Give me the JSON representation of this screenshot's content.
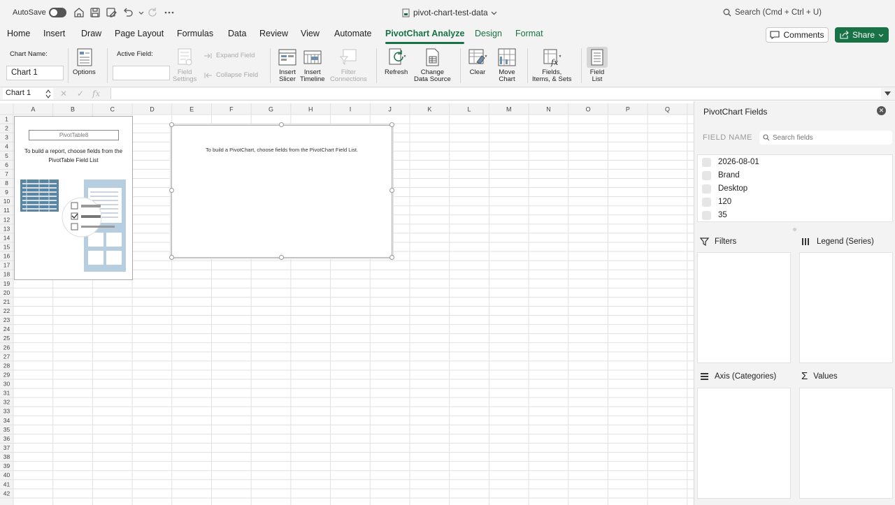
{
  "titlebar": {
    "autosave_label": "AutoSave",
    "doc_title": "pivot-chart-test-data",
    "search_placeholder": "Search (Cmd + Ctrl + U)"
  },
  "tabs": [
    "Home",
    "Insert",
    "Draw",
    "Page Layout",
    "Formulas",
    "Data",
    "Review",
    "View",
    "Automate",
    "PivotChart Analyze",
    "Design",
    "Format"
  ],
  "active_tab": "PivotChart Analyze",
  "header_buttons": {
    "comments": "Comments",
    "share": "Share"
  },
  "ribbon": {
    "chart_name_label": "Chart Name:",
    "chart_name_value": "Chart 1",
    "options": "Options",
    "active_field_label": "Active Field:",
    "active_field_value": "",
    "field_settings": [
      "Field",
      "Settings"
    ],
    "expand_field": "Expand Field",
    "collapse_field": "Collapse Field",
    "insert_slicer": [
      "Insert",
      "Slicer"
    ],
    "insert_timeline": [
      "Insert",
      "Timeline"
    ],
    "filter_connections": [
      "Filter",
      "Connections"
    ],
    "refresh": "Refresh",
    "change_data_source": [
      "Change",
      "Data Source"
    ],
    "clear": "Clear",
    "move_chart": [
      "Move",
      "Chart"
    ],
    "fields_items_sets": [
      "Fields,",
      "Items, & Sets"
    ],
    "field_list": [
      "Field",
      "List"
    ]
  },
  "formula_bar": {
    "name_box": "Chart 1",
    "formula": ""
  },
  "sheet": {
    "columns": [
      "A",
      "B",
      "C",
      "D",
      "E",
      "F",
      "G",
      "H",
      "I",
      "J",
      "K",
      "L",
      "M",
      "N",
      "O",
      "P",
      "Q"
    ],
    "row_count": 42,
    "pivot_table": {
      "name": "PivotTable8",
      "message": "To build a report, choose fields from the PivotTable Field List"
    },
    "pivot_chart": {
      "message": "To build a PivotChart, choose fields from the PivotChart Field List."
    }
  },
  "pane": {
    "title": "PivotChart Fields",
    "field_name_label": "FIELD NAME",
    "search_placeholder": "Search fields",
    "fields": [
      "2026-08-01",
      "Brand",
      "Desktop",
      "120",
      "35"
    ],
    "areas": {
      "filters": "Filters",
      "legend": "Legend (Series)",
      "axis": "Axis (Categories)",
      "values": "Values"
    }
  },
  "colors": {
    "accent": "#177245",
    "ribbon_bg": "#f3f3f3",
    "grid_line": "#e1e1e1",
    "header_bg": "#f3f3f3"
  }
}
